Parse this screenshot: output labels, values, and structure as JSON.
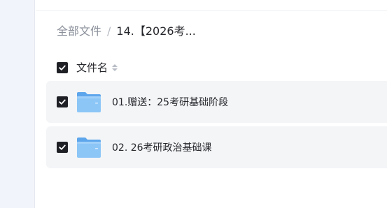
{
  "breadcrumb": {
    "root": "全部文件",
    "separator": "/",
    "current": "14.【2026考..."
  },
  "table_header": {
    "column_name": "文件名",
    "select_all_checked": true,
    "sort_icon": "sort-updown-icon"
  },
  "files": [
    {
      "name": "01.赠送：25考研基础阶段",
      "type": "folder",
      "checked": true,
      "icon": "folder-icon"
    },
    {
      "name": "02. 26考研政治基础课",
      "type": "folder",
      "checked": true,
      "icon": "folder-icon"
    }
  ],
  "colors": {
    "accent_checkbox": "#1f2026",
    "row_background": "#f4f5f7",
    "folder_blue": "#7fbef5",
    "rail_background": "#f2f4fb"
  }
}
